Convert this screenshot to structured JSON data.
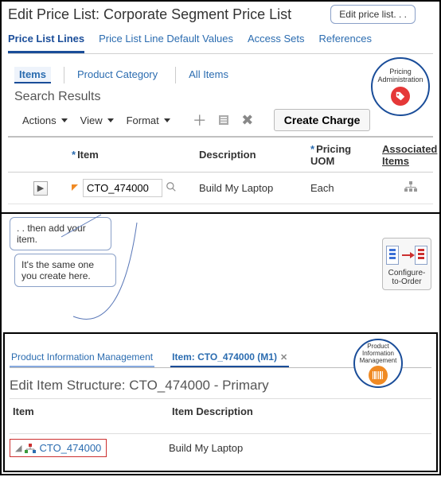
{
  "top": {
    "title": "Edit Price List: Corporate Segment Price List",
    "callout_title": "Edit price list. . .",
    "tabs": [
      "Price List Lines",
      "Price List Line Default Values",
      "Access Sets",
      "References"
    ],
    "sub_tabs": [
      "Items",
      "Product Category",
      "All Items"
    ],
    "pricing_badge": "Pricing Administration",
    "search_header": "Search Results",
    "menus": {
      "actions": "Actions",
      "view": "View",
      "format": "Format"
    },
    "create_charge": "Create Charge",
    "columns": {
      "item": "Item",
      "description": "Description",
      "uom": "Pricing UOM",
      "assoc": "Associated Items"
    },
    "row": {
      "item": "CTO_474000",
      "description": "Build My Laptop",
      "uom": "Each"
    }
  },
  "callouts": {
    "c1": ". . then add your item.",
    "c2": "It's the same one you create here."
  },
  "cto_label": "Configure-to-Order",
  "bottom": {
    "tabs": {
      "pim": "Product Information Management",
      "item": "Item: CTO_474000 (M1)"
    },
    "badge": "Product Information Management",
    "title": "Edit Item Structure: CTO_474000 - Primary",
    "columns": {
      "item": "Item",
      "desc": "Item Description"
    },
    "row": {
      "item": "CTO_474000",
      "desc": "Build My Laptop"
    }
  }
}
